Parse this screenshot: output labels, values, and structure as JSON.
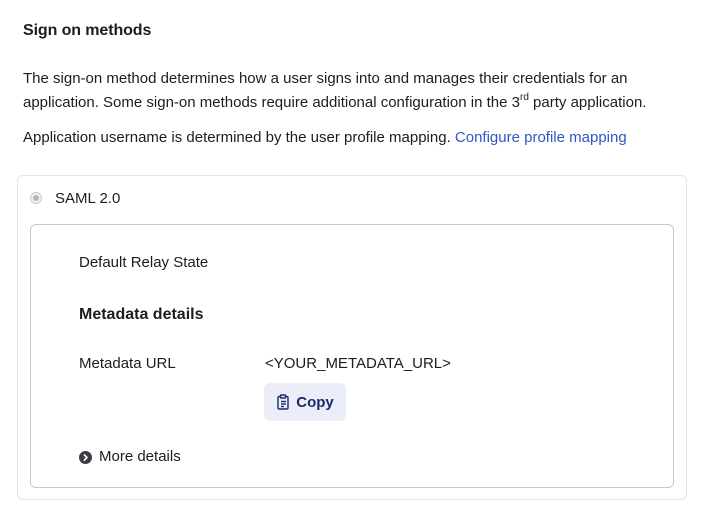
{
  "section": {
    "title": "Sign on methods",
    "description_part1": "The sign-on method determines how a user signs into and manages their credentials for an application. Some sign-on methods require additional configuration in the 3",
    "description_sup": "rd",
    "description_part2": " party application.",
    "username_text": "Application username is determined by the user profile mapping. ",
    "username_link": "Configure profile mapping"
  },
  "method": {
    "label": "SAML 2.0",
    "selected": true
  },
  "details": {
    "relay_state_label": "Default Relay State",
    "metadata_title": "Metadata details",
    "metadata_url_label": "Metadata URL",
    "metadata_url_value": "<YOUR_METADATA_URL>",
    "copy_label": "Copy",
    "more_details_label": "More details"
  },
  "colors": {
    "link": "#2f56c6",
    "copy_button_bg": "#ebeef9",
    "copy_button_text": "#1a2a6c",
    "border_outer": "#e3e3e6",
    "border_inner": "#c9c9ce"
  },
  "icons": {
    "copy": "clipboard-icon",
    "more_details": "chevron-right-circle-icon",
    "radio": "radio-selected-disabled"
  }
}
